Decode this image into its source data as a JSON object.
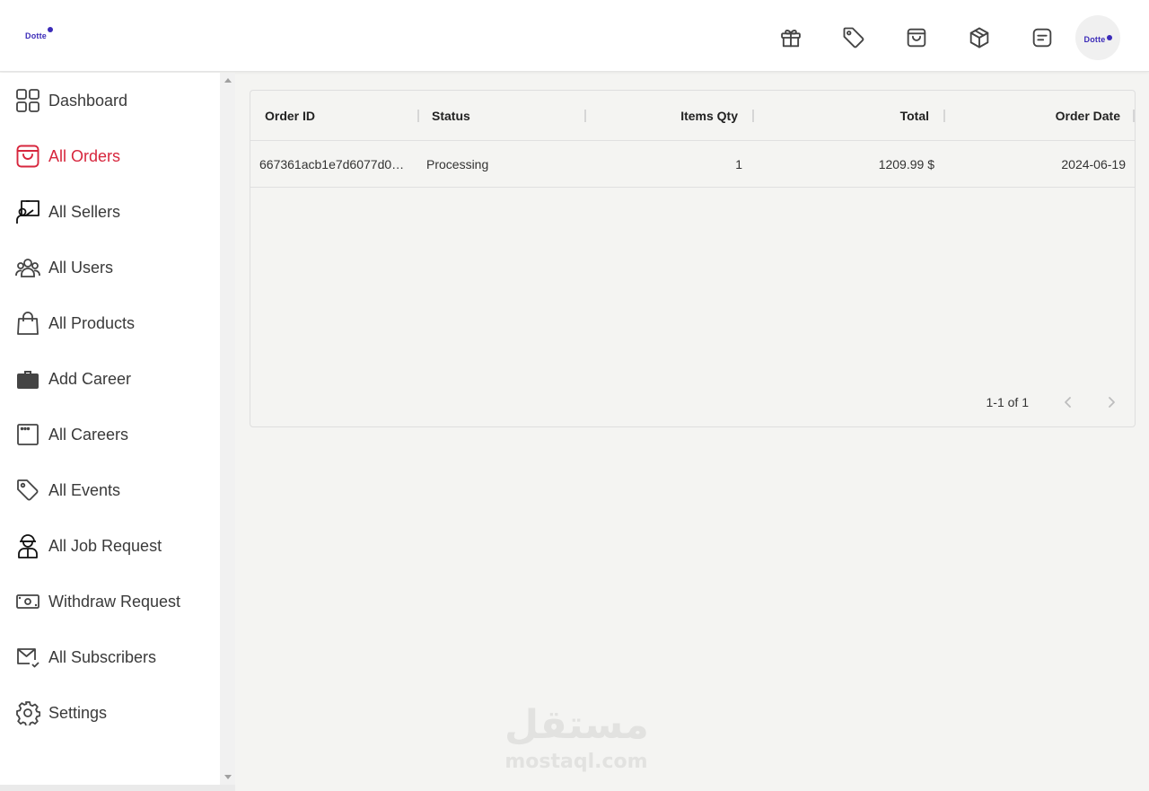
{
  "brand": {
    "logo_text": "Dotte",
    "accent": "#3b2bb8",
    "active_color": "#d7263d"
  },
  "header": {
    "icons": [
      "gift-icon",
      "tag-icon",
      "shopping-bag-icon",
      "box-icon",
      "note-icon"
    ],
    "avatar_text": "Dotte"
  },
  "sidebar": {
    "items": [
      {
        "label": "Dashboard",
        "icon": "grid-icon",
        "active": false
      },
      {
        "label": "All Orders",
        "icon": "shopping-bag-icon",
        "active": true
      },
      {
        "label": "All Sellers",
        "icon": "seller-icon",
        "active": false
      },
      {
        "label": "All Users",
        "icon": "users-icon",
        "active": false
      },
      {
        "label": "All Products",
        "icon": "handbag-icon",
        "active": false
      },
      {
        "label": "Add Career",
        "icon": "briefcase-icon",
        "active": false
      },
      {
        "label": "All Careers",
        "icon": "window-icon",
        "active": false
      },
      {
        "label": "All Events",
        "icon": "tag-icon",
        "active": false
      },
      {
        "label": "All Job Request",
        "icon": "worker-icon",
        "active": false
      },
      {
        "label": "Withdraw Request",
        "icon": "cash-icon",
        "active": false
      },
      {
        "label": "All Subscribers",
        "icon": "mail-icon",
        "active": false
      },
      {
        "label": "Settings",
        "icon": "gear-icon",
        "active": false
      }
    ]
  },
  "orders_table": {
    "columns": [
      "Order ID",
      "Status",
      "Items Qty",
      "Total",
      "Order Date"
    ],
    "rows": [
      {
        "order_id": "667361acb1e7d6077d0…",
        "status": "Processing",
        "items_qty": "1",
        "total": "1209.99 $",
        "order_date": "2024-06-19"
      }
    ],
    "pagination": {
      "text": "1-1 of 1"
    }
  },
  "watermark": {
    "arabic": "مستقل",
    "latin": "mostaql.com"
  }
}
